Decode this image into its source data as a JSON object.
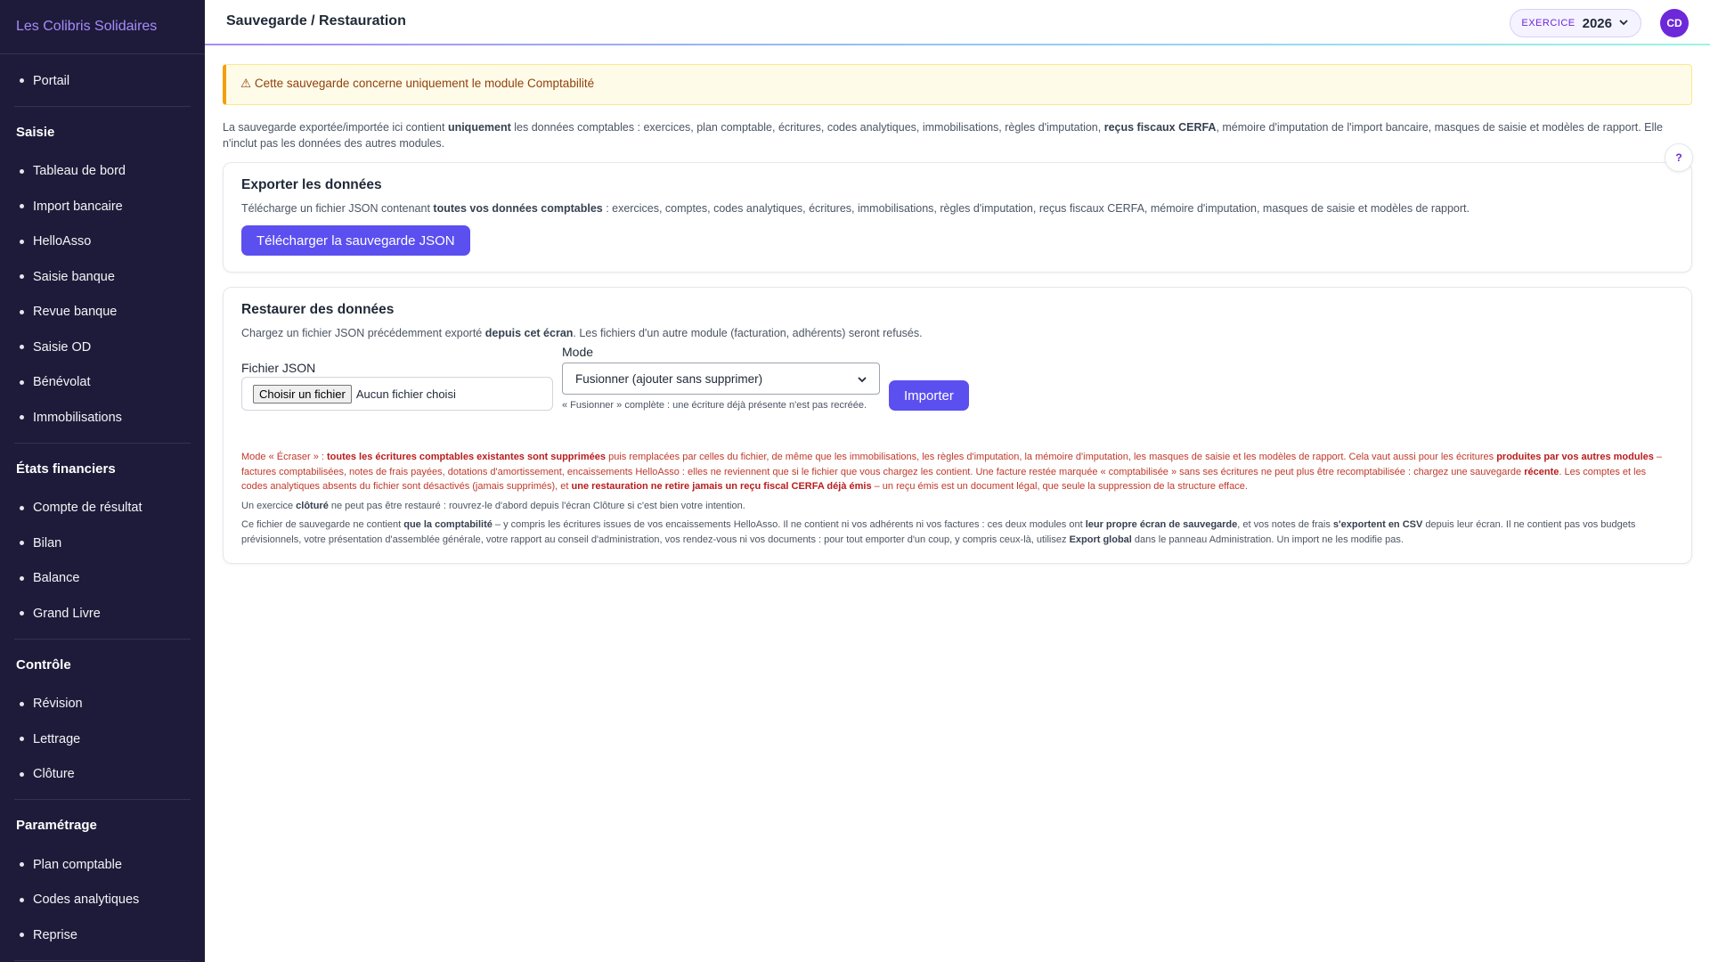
{
  "sidebar": {
    "brand": "Les Colibris Solidaires",
    "portal": "Portail",
    "sections": [
      {
        "title": "Saisie",
        "items": [
          "Tableau de bord",
          "Import bancaire",
          "HelloAsso",
          "Saisie banque",
          "Revue banque",
          "Saisie OD",
          "Bénévolat",
          "Immobilisations"
        ]
      },
      {
        "title": "États financiers",
        "items": [
          "Compte de résultat",
          "Bilan",
          "Balance",
          "Grand Livre"
        ]
      },
      {
        "title": "Contrôle",
        "items": [
          "Révision",
          "Lettrage",
          "Clôture"
        ]
      },
      {
        "title": "Paramétrage",
        "items": [
          "Plan comptable",
          "Codes analytiques",
          "Reprise"
        ]
      }
    ]
  },
  "header": {
    "title": "Sauvegarde / Restauration",
    "exercice_label": "EXERCICE",
    "exercice_year": "2026",
    "avatar": "CD"
  },
  "warning": "⚠ Cette sauvegarde concerne uniquement le module Comptabilité",
  "intro": {
    "p1": "La sauvegarde exportée/importée ici contient ",
    "b1": "uniquement",
    "p2": " les données comptables : exercices, plan comptable, écritures, codes analytiques, immobilisations, règles d'imputation, ",
    "b2": "reçus fiscaux CERFA",
    "p3": ", mémoire d'imputation de l'import bancaire, masques de saisie et modèles de rapport. Elle n'inclut pas les données des autres modules."
  },
  "help_label": "?",
  "export": {
    "title": "Exporter les données",
    "desc_1": "Télécharge un fichier JSON contenant ",
    "desc_b": "toutes vos données comptables",
    "desc_2": " : exercices, comptes, codes analytiques, écritures, immobilisations, règles d'imputation, reçus fiscaux CERFA, mémoire d'imputation, masques de saisie et modèles de rapport.",
    "button": "Télécharger la sauvegarde JSON"
  },
  "restore": {
    "title": "Restaurer des données",
    "desc_1": "Chargez un fichier JSON précédemment exporté ",
    "desc_b": "depuis cet écran",
    "desc_2": ". Les fichiers d'un autre module (facturation, adhérents) seront refusés.",
    "file_label": "Fichier JSON",
    "file_button": "Choisir un fichier",
    "file_none": "Aucun fichier choisi",
    "mode_label": "Mode",
    "mode_value": "Fusionner (ajouter sans supprimer)",
    "mode_hint": "« Fusionner » complète : une écriture déjà présente n'est pas recréée.",
    "import_button": "Importer",
    "danger": {
      "t1": "Mode « Écraser » : ",
      "b1": "toutes les écritures comptables existantes sont supprimées",
      "t2": " puis remplacées par celles du fichier, de même que les immobilisations, les règles d'imputation, la mémoire d'imputation, les masques de saisie et les modèles de rapport. Cela vaut aussi pour les écritures ",
      "b2": "produites par vos autres modules",
      "t3": " – factures comptabilisées, notes de frais payées, dotations d'amortissement, encaissements HelloAsso : elles ne reviennent que si le fichier que vous chargez les contient. Une facture restée marquée « comptabilisée » sans ses écritures ne peut plus être recomptabilisée : chargez une sauvegarde ",
      "b3": "récente",
      "t4": ". Les comptes et les codes analytiques absents du fichier sont désactivés (jamais supprimés), et ",
      "b4": "une restauration ne retire jamais un reçu fiscal CERFA déjà émis",
      "t5": " – un reçu émis est un document légal, que seule la suppression de la structure efface."
    },
    "closed": {
      "t1": "Un exercice ",
      "b1": "clôturé",
      "t2": " ne peut pas être restauré : rouvrez-le d'abord depuis l'écran Clôture si c'est bien votre intention."
    },
    "scope": {
      "t1": "Ce fichier de sauvegarde ne contient ",
      "b1": "que la comptabilité",
      "t2": " – y compris les écritures issues de vos encaissements HelloAsso. Il ne contient ni vos adhérents ni vos factures : ces deux modules ont ",
      "b2": "leur propre écran de sauvegarde",
      "t3": ", et vos notes de frais ",
      "b3": "s'exportent en CSV",
      "t4": " depuis leur écran. Il ne contient pas vos budgets prévisionnels, votre présentation d'assemblée générale, votre rapport au conseil d'administration, vos rendez-vous ni vos documents : pour tout emporter d'un coup, y compris ceux-là, utilisez ",
      "b4": "Export global",
      "t5": " dans le panneau Administration. Un import ne les modifie pas."
    }
  }
}
